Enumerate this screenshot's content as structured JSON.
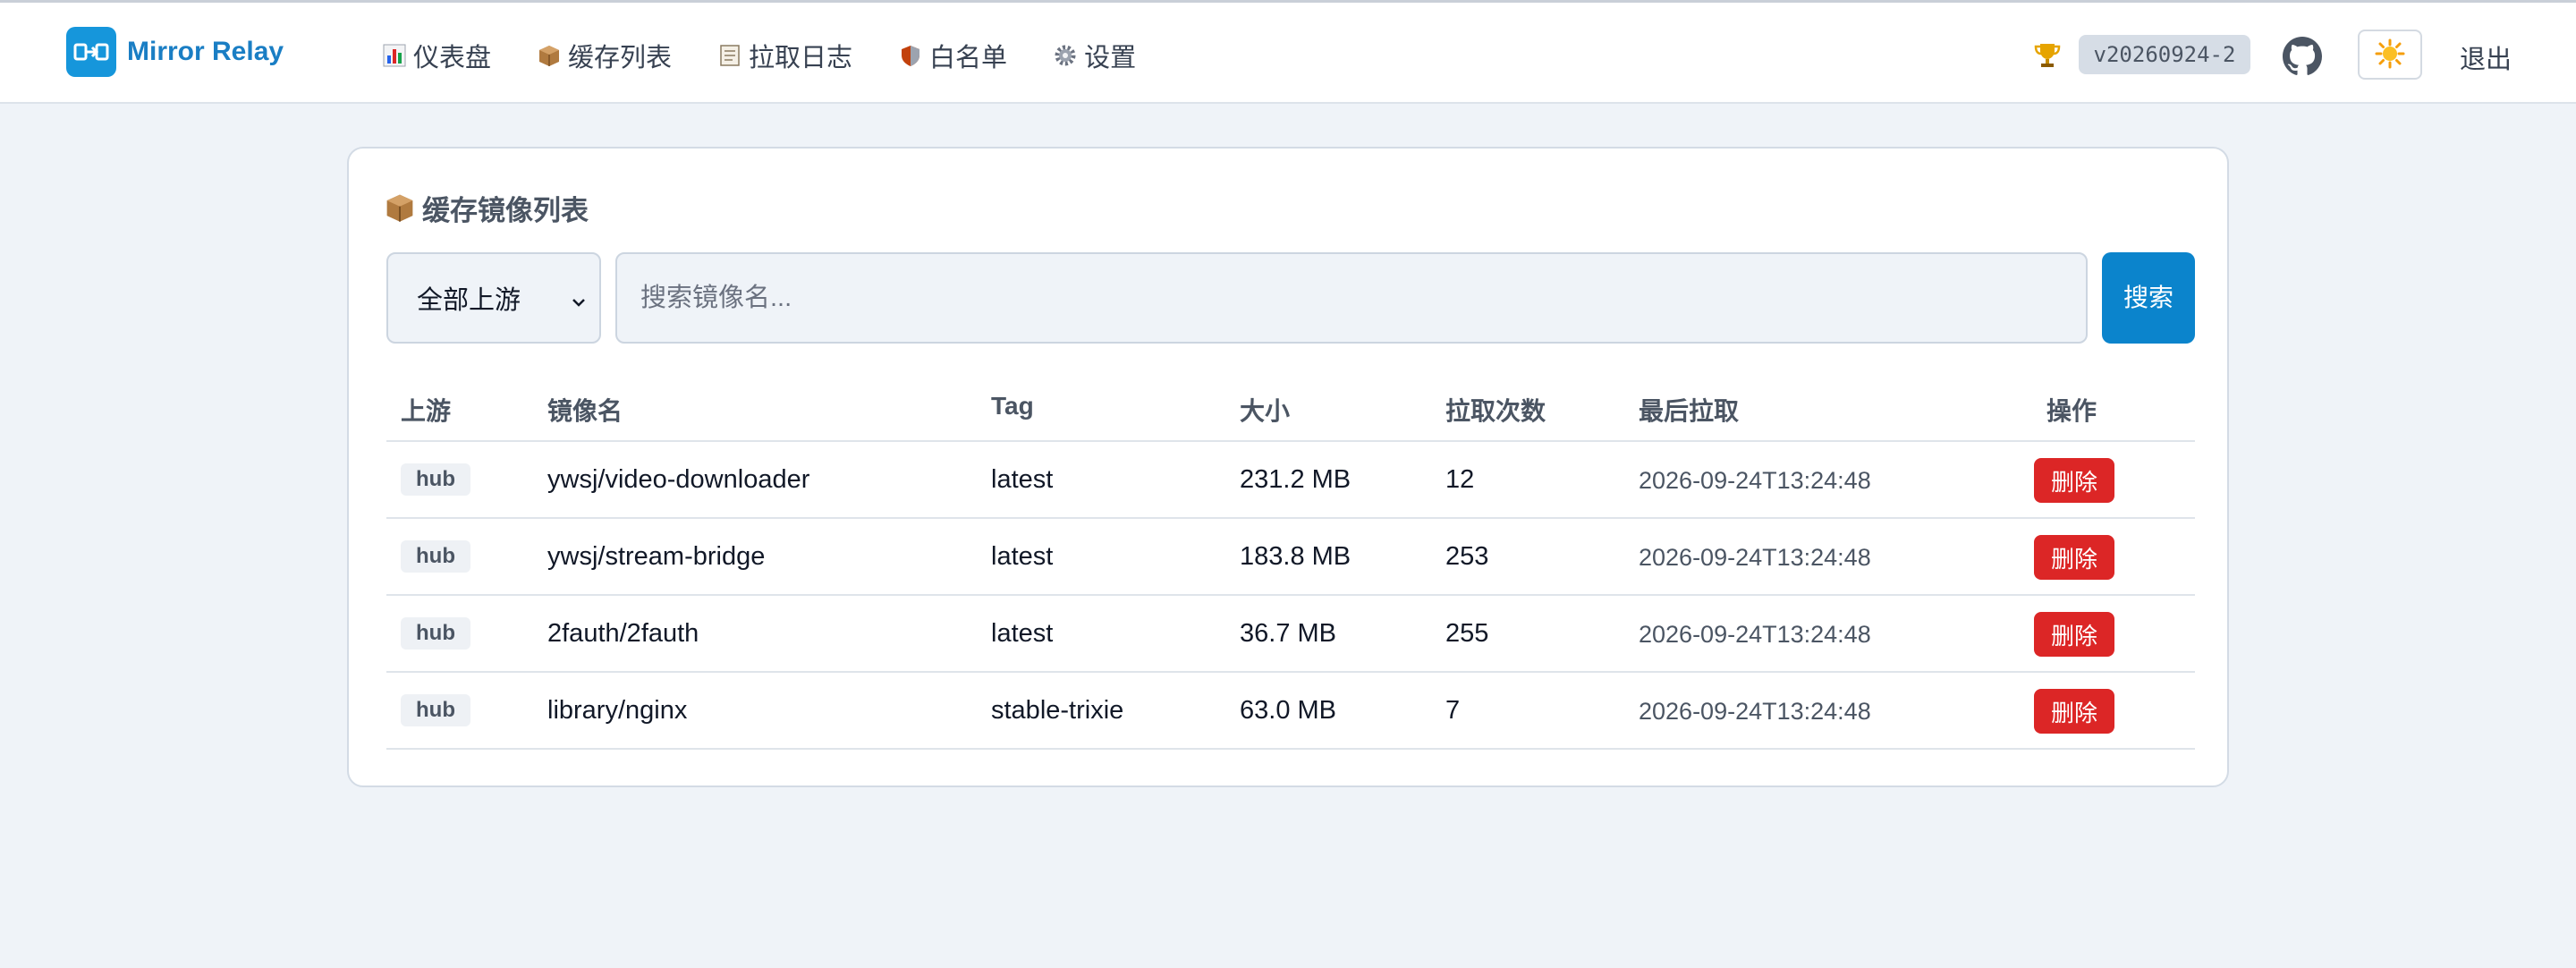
{
  "app": {
    "name": "Mirror Relay",
    "version": "v20260924-2",
    "logout_label": "退出"
  },
  "nav": [
    {
      "icon": "bar-chart-icon",
      "label": "仪表盘"
    },
    {
      "icon": "package-icon",
      "label": "缓存列表"
    },
    {
      "icon": "log-icon",
      "label": "拉取日志"
    },
    {
      "icon": "shield-icon",
      "label": "白名单"
    },
    {
      "icon": "gear-icon",
      "label": "设置"
    }
  ],
  "card": {
    "title": "缓存镜像列表",
    "upstream_select": {
      "selected": "全部上游"
    },
    "search": {
      "placeholder": "搜索镜像名...",
      "value": "",
      "button_label": "搜索"
    }
  },
  "table": {
    "columns": [
      "上游",
      "镜像名",
      "Tag",
      "大小",
      "拉取次数",
      "最后拉取",
      "操作"
    ],
    "rows": [
      {
        "upstream": "hub",
        "name": "ywsj/video-downloader",
        "tag": "latest",
        "size": "231.2 MB",
        "pulls": "12",
        "last_pull": "2026-09-24T13:24:48",
        "action": "删除"
      },
      {
        "upstream": "hub",
        "name": "ywsj/stream-bridge",
        "tag": "latest",
        "size": "183.8 MB",
        "pulls": "253",
        "last_pull": "2026-09-24T13:24:48",
        "action": "删除"
      },
      {
        "upstream": "hub",
        "name": "2fauth/2fauth",
        "tag": "latest",
        "size": "36.7 MB",
        "pulls": "255",
        "last_pull": "2026-09-24T13:24:48",
        "action": "删除"
      },
      {
        "upstream": "hub",
        "name": "library/nginx",
        "tag": "stable-trixie",
        "size": "63.0 MB",
        "pulls": "7",
        "last_pull": "2026-09-24T13:24:48",
        "action": "删除"
      }
    ]
  },
  "colors": {
    "brand": "#1a7ec4",
    "primary_button": "#0b84cc",
    "danger_button": "#dc2626",
    "page_background": "#eff3f8"
  }
}
